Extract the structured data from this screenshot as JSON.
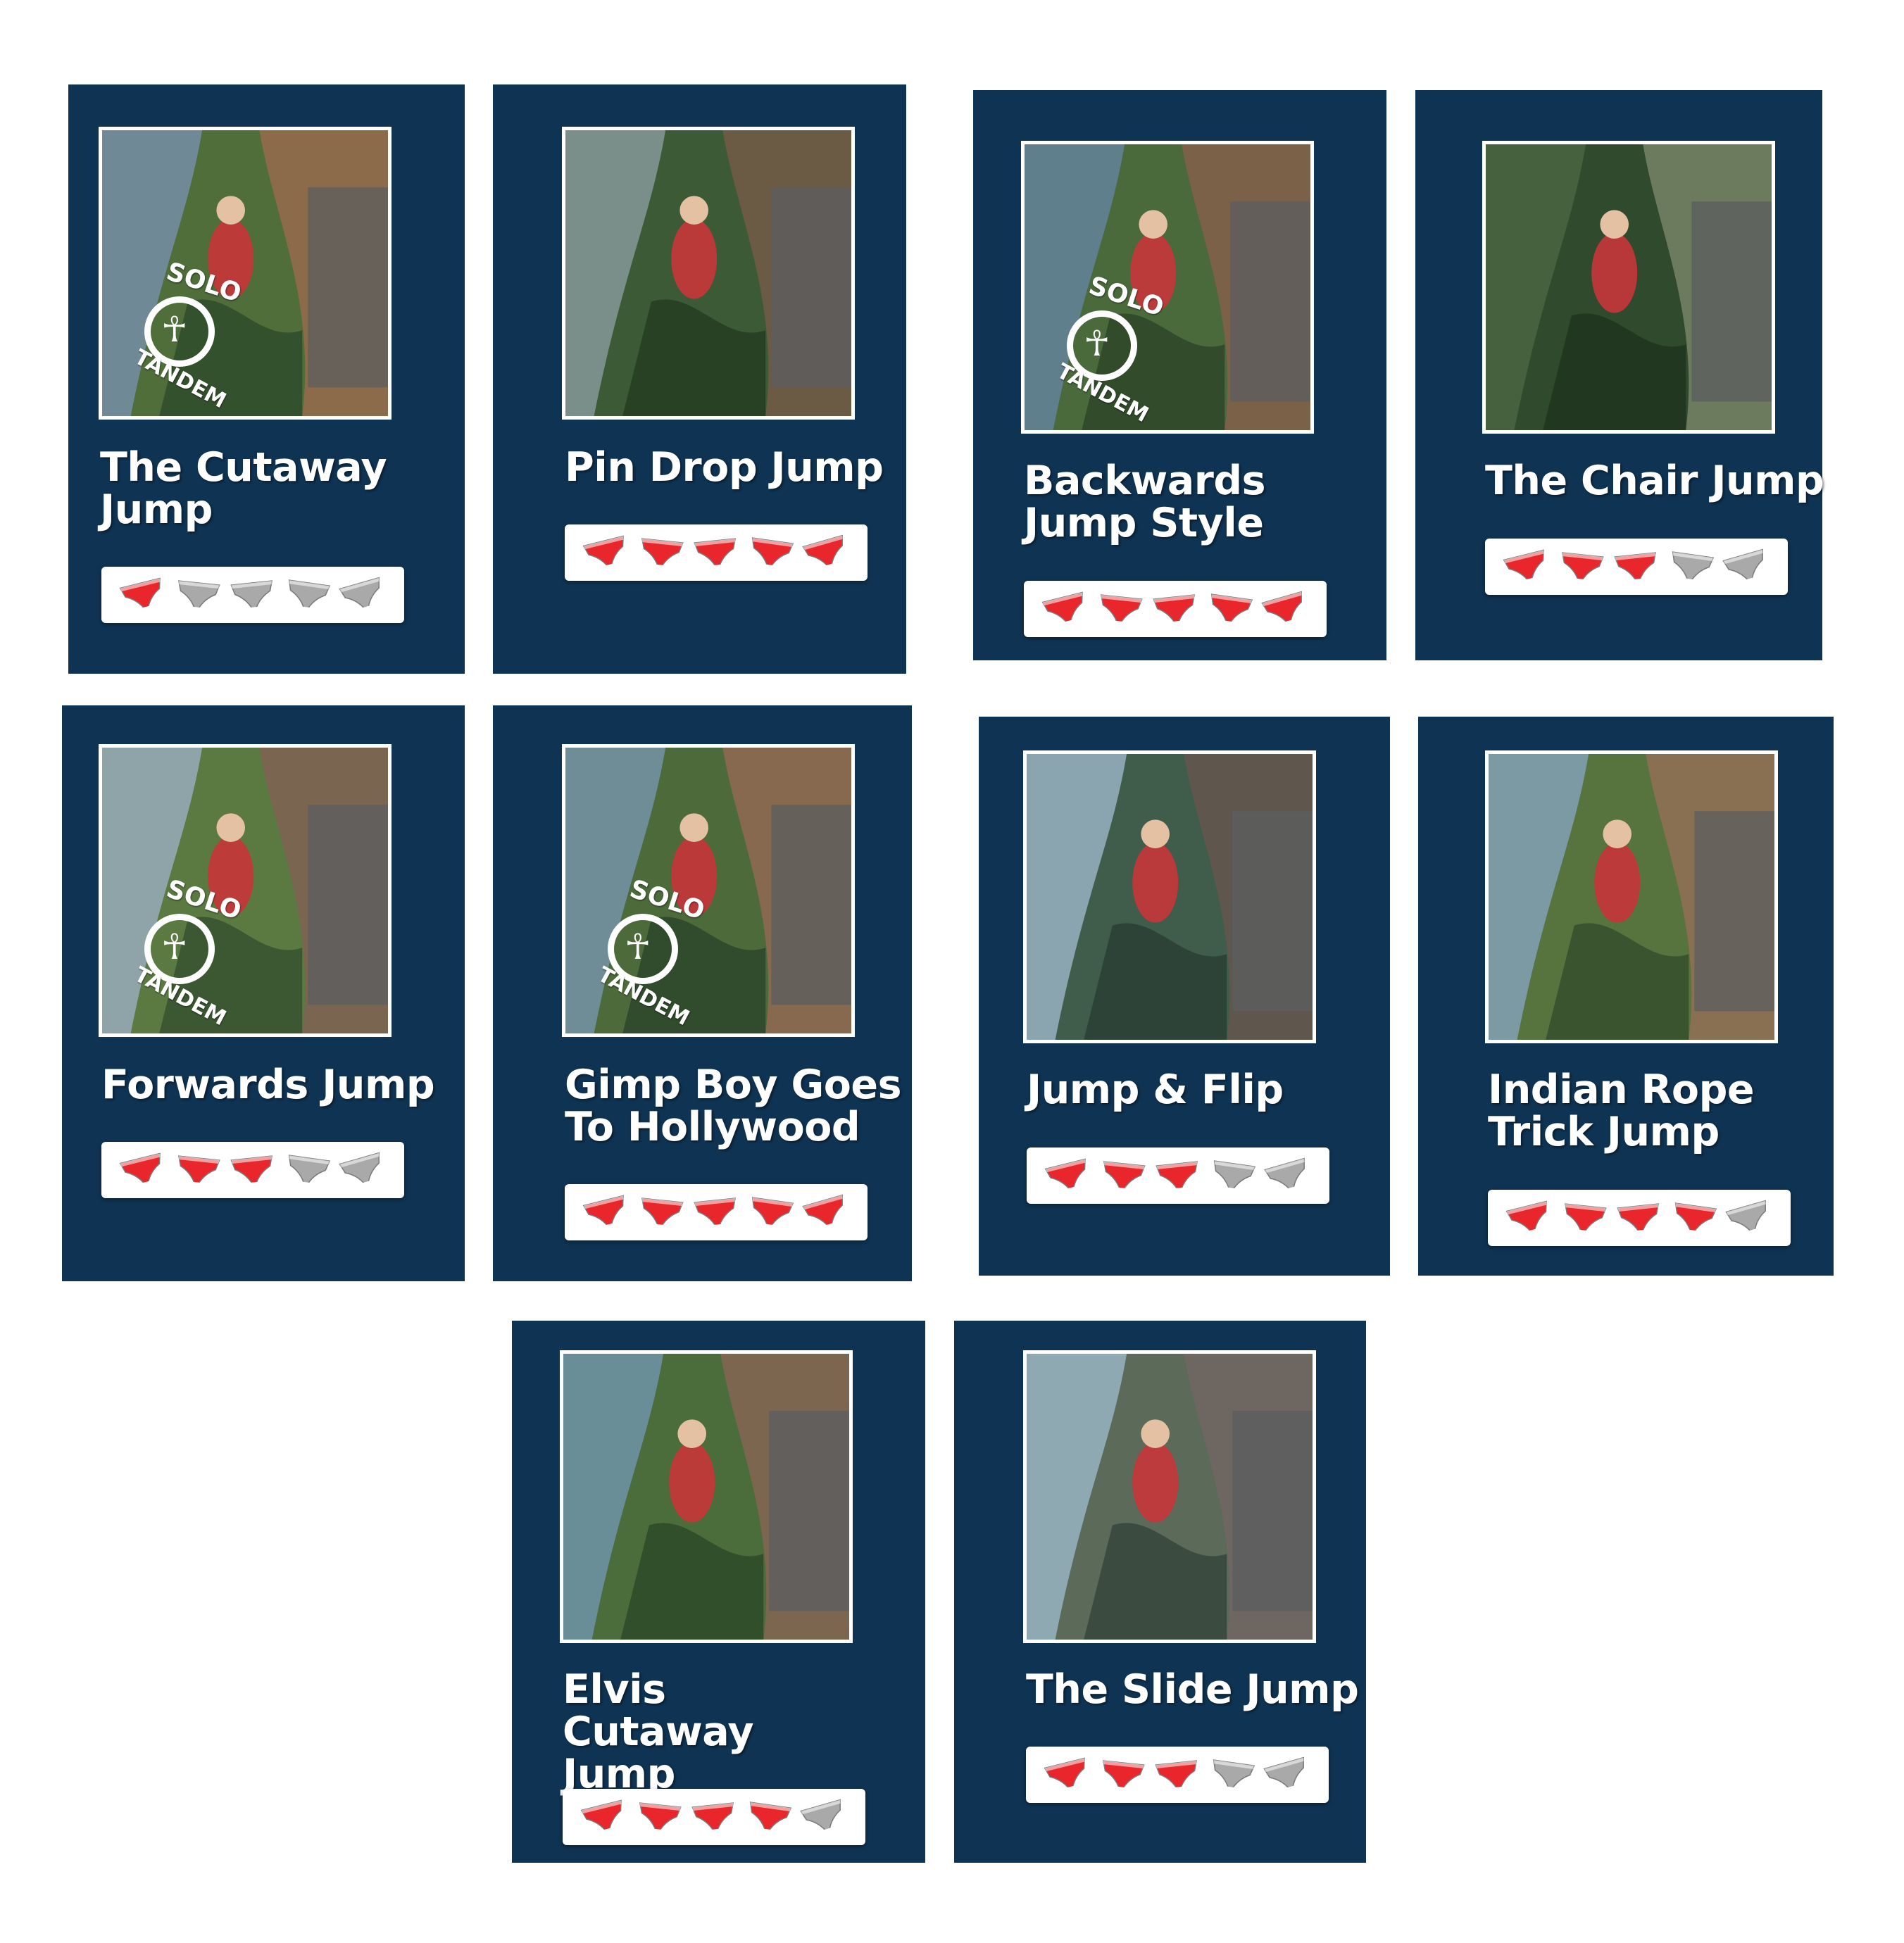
{
  "colors": {
    "card_bg": "#0f3352",
    "rating_on": "#e8262b",
    "rating_off": "#a9a9a9"
  },
  "rating_icon": "underpants-icon",
  "rating_max": 5,
  "badge": {
    "top": "SOLO",
    "bottom": "TANDEM",
    "icon": "solo-tandem-logo"
  },
  "jumps": [
    {
      "title": "The Cutaway Jump",
      "rating": 1,
      "badge": true
    },
    {
      "title": "Pin Drop Jump",
      "rating": 5,
      "badge": false
    },
    {
      "title": "Backwards Jump Style",
      "rating": 5,
      "badge": true
    },
    {
      "title": "The Chair Jump",
      "rating": 3,
      "badge": false
    },
    {
      "title": "Forwards Jump",
      "rating": 3,
      "badge": true
    },
    {
      "title": "Gimp Boy Goes To Hollywood",
      "rating": 5,
      "badge": true
    },
    {
      "title": "Jump & Flip",
      "rating": 3,
      "badge": false
    },
    {
      "title": "Indian Rope Trick Jump",
      "rating": 4,
      "badge": false
    },
    {
      "title": "Elvis Cutaway Jump",
      "rating": 4,
      "badge": false
    },
    {
      "title": "The Slide Jump",
      "rating": 3,
      "badge": false
    }
  ]
}
